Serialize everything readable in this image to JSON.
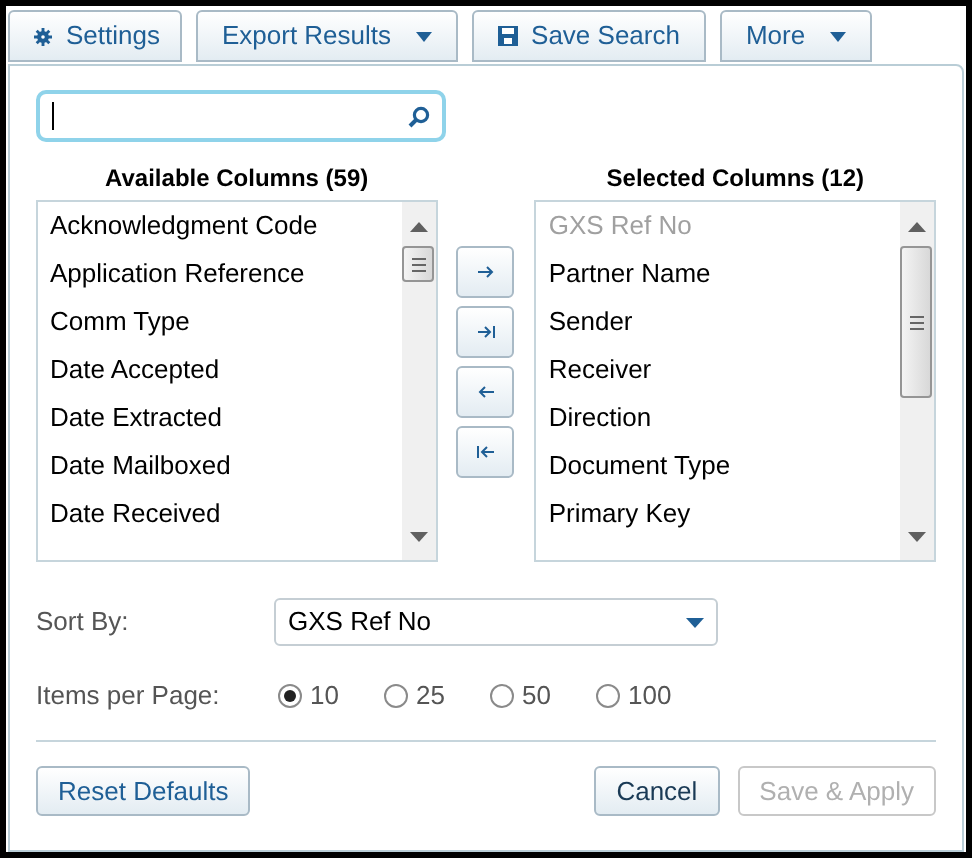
{
  "toolbar": [
    {
      "label": "Settings",
      "kind": "gear"
    },
    {
      "label": "Export Results",
      "kind": "dropdown"
    },
    {
      "label": "Save Search",
      "kind": "disk"
    },
    {
      "label": "More",
      "kind": "dropdown"
    }
  ],
  "search": {
    "kind": "field"
  },
  "available": {
    "title": "Available Columns (59)",
    "items": [
      {
        "label": "Acknowledgment Code",
        "disabled": false
      },
      {
        "label": "Application Reference",
        "disabled": false
      },
      {
        "label": "Comm Type",
        "disabled": false
      },
      {
        "label": "Date Accepted",
        "disabled": false
      },
      {
        "label": "Date Extracted",
        "disabled": false
      },
      {
        "label": "Date Mailboxed",
        "disabled": false
      },
      {
        "label": "Date Received",
        "disabled": false
      }
    ]
  },
  "move_buttons": [
    {
      "kind": "right"
    },
    {
      "kind": "all-right"
    },
    {
      "kind": "left"
    },
    {
      "kind": "all-left"
    }
  ],
  "selected": {
    "title": "Selected Columns (12)",
    "items": [
      {
        "label": "GXS Ref No",
        "disabled": true
      },
      {
        "label": "Partner Name",
        "disabled": false
      },
      {
        "label": "Sender",
        "disabled": false
      },
      {
        "label": "Receiver",
        "disabled": false
      },
      {
        "label": "Direction",
        "disabled": false
      },
      {
        "label": "Document Type",
        "disabled": false
      },
      {
        "label": "Primary Key",
        "disabled": false
      }
    ]
  },
  "sort_by": {
    "label": "Sort By:",
    "value": "GXS Ref No"
  },
  "items_per_page": {
    "label": "Items per Page:",
    "options": [
      {
        "label": "10",
        "selected": true
      },
      {
        "label": "25",
        "selected": false
      },
      {
        "label": "50",
        "selected": false
      },
      {
        "label": "100",
        "selected": false
      }
    ]
  },
  "buttons": [
    {
      "label": "Reset Defaults",
      "disabled": false
    },
    {
      "label": "Cancel",
      "disabled": false
    },
    {
      "label": "Save & Apply",
      "disabled": true
    }
  ]
}
